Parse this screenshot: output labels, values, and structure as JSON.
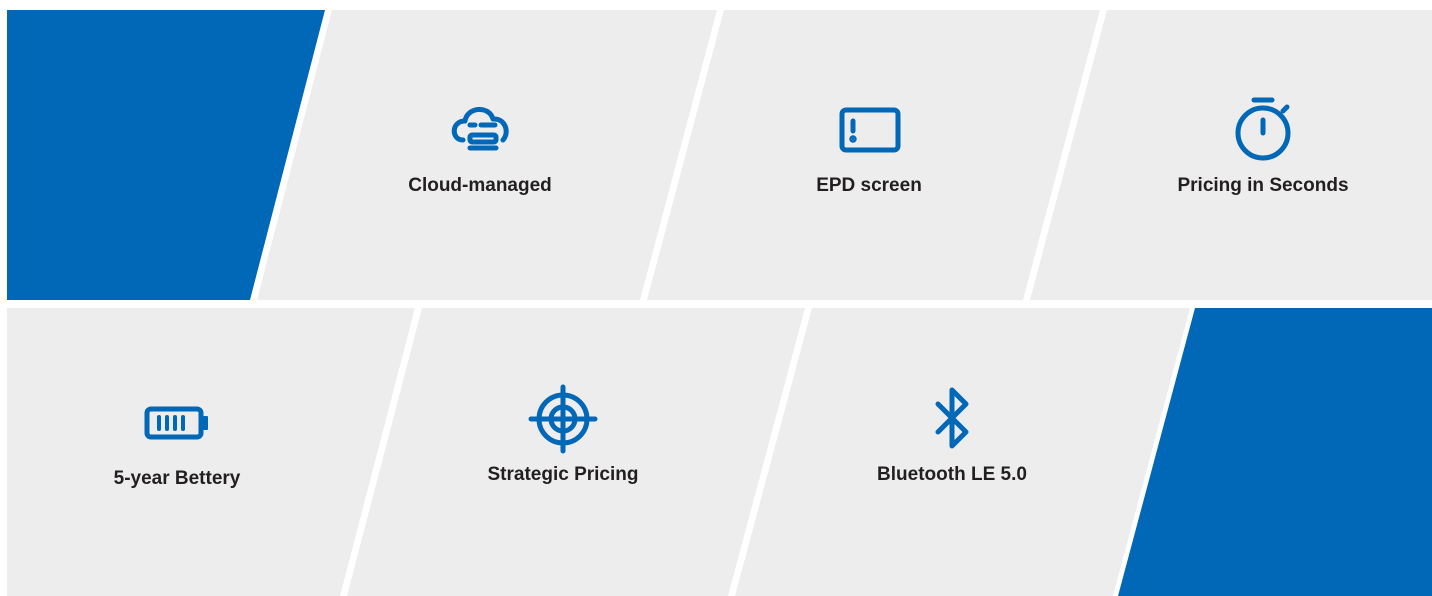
{
  "colors": {
    "accent": "#0068b7",
    "tile": "#ededed",
    "label": "#231f20",
    "background": "#ffffff"
  },
  "row1": {
    "features": [
      {
        "label": "Cloud-managed",
        "icon": "cloud-icon"
      },
      {
        "label": "EPD screen",
        "icon": "screen-icon"
      },
      {
        "label": "Pricing in Seconds",
        "icon": "stopwatch-icon"
      }
    ]
  },
  "row2": {
    "features": [
      {
        "label": "5-year Bettery",
        "icon": "battery-icon"
      },
      {
        "label": "Strategic Pricing",
        "icon": "target-icon"
      },
      {
        "label": "Bluetooth LE 5.0",
        "icon": "bluetooth-icon"
      }
    ]
  }
}
